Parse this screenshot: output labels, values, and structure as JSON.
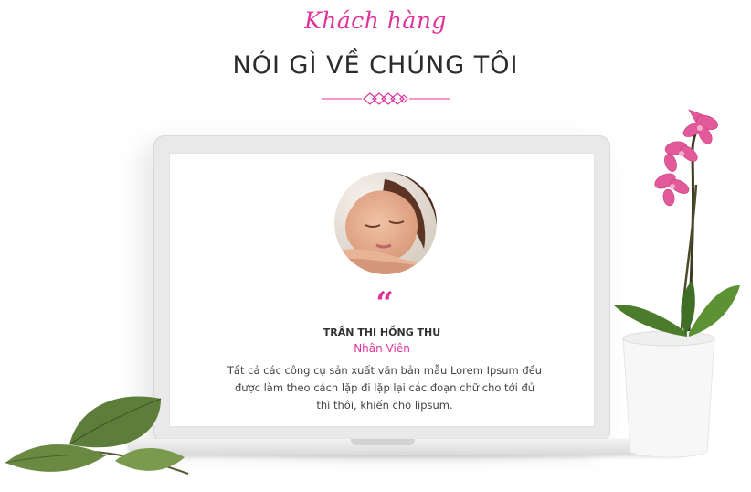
{
  "section": {
    "script_title": "Khách hàng",
    "main_title": "NÓI GÌ VỀ CHÚNG TÔI"
  },
  "testimonial": {
    "quote_mark": "“",
    "name": "TRẦN THI HỒNG THU",
    "role": "Nhân Viên",
    "text": "Tất cả các công cụ sản xuất văn bản mẫu Lorem Ipsum đều được làm theo cách lặp đi lặp lại các đoạn chữ cho tới đủ thì thôi, khiến cho lipsum."
  },
  "colors": {
    "accent": "#e0339a",
    "title": "#2b2b2b",
    "text": "#444444",
    "laptop_frame": "#e9e9e9"
  },
  "icons": [
    "ornament-divider-icon",
    "quote-icon"
  ]
}
